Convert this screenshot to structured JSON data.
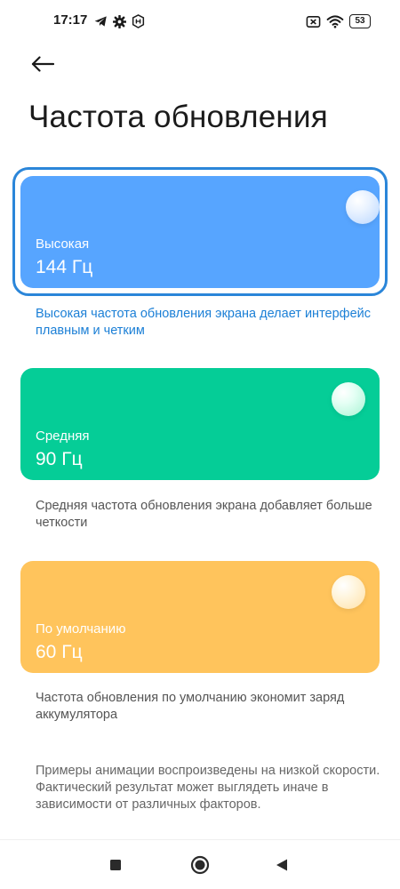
{
  "status_bar": {
    "time": "17:17",
    "left_icons": [
      "telegram-icon",
      "gear-icon",
      "hd-shield-icon"
    ],
    "right_icons": [
      "no-sim-icon",
      "wifi-icon",
      "battery-icon"
    ],
    "battery_level": "53"
  },
  "header": {
    "back_icon": "arrow-left-icon",
    "title": "Частота обновления"
  },
  "options": [
    {
      "label": "Высокая",
      "value": "144 Гц",
      "description": "Высокая частота обновления экрана делает интерфейс плавным и четким",
      "color": "#57a5ff",
      "selected": true
    },
    {
      "label": "Средняя",
      "value": "90 Гц",
      "description": "Средняя частота обновления экрана добавляет больше четкости",
      "color": "#05cd97",
      "selected": false
    },
    {
      "label": "По умолчанию",
      "value": "60 Гц",
      "description": "Частота обновления по умолчанию экономит заряд аккумулятора",
      "color": "#ffc45c",
      "selected": false
    }
  ],
  "footnote": "Примеры анимации воспроизведены на низкой скорости. Фактический результат может выглядеть иначе в зависимости от различных факторов.",
  "nav_bar": {
    "icons": [
      "recents-square-icon",
      "home-circle-icon",
      "back-triangle-icon"
    ]
  },
  "colors": {
    "accent": "#2b86d9",
    "selected_description": "#1b7fd6"
  }
}
